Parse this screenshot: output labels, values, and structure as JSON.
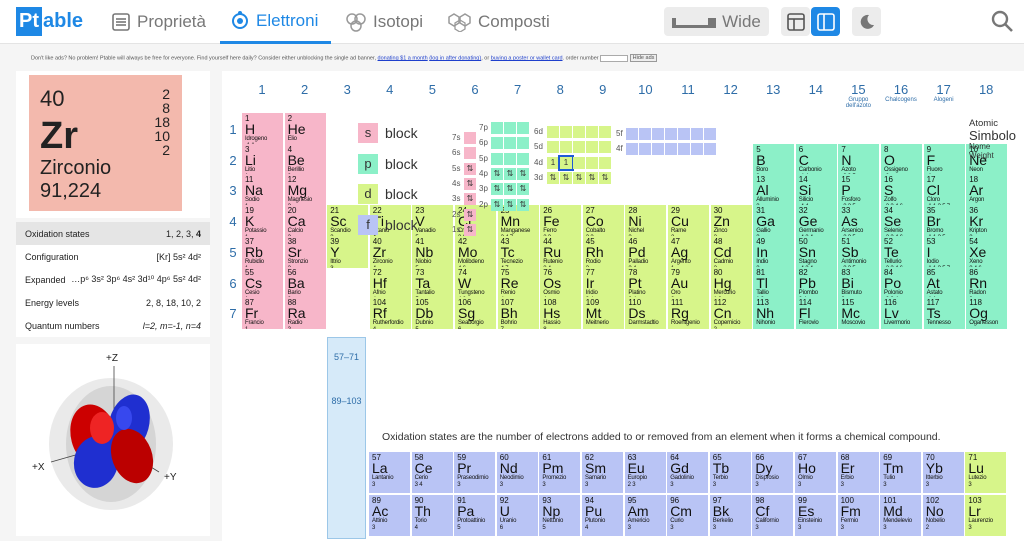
{
  "logo": {
    "part1": "Pt",
    "part2": "able"
  },
  "tabs": [
    {
      "label": "Proprietà"
    },
    {
      "label": "Elettroni"
    },
    {
      "label": "Isotopi"
    },
    {
      "label": "Composti"
    }
  ],
  "wide_label": "Wide",
  "ad": {
    "text1": "Don't like ads? No problem! Ptable will always be free for everyone. Find yourself here daily? Consider either unblocking the single ad banner,",
    "link1": "donating $1 a month",
    "link2": "(log in after donating)",
    "or": ", or",
    "link3": "buying a poster or wallet card",
    "text2": ". order number",
    "hide": "Hide ads"
  },
  "element": {
    "number": "40",
    "symbol": "Zr",
    "name": "Zirconio",
    "weight": "91,224",
    "shells": [
      "2",
      "8",
      "18",
      "10",
      "2"
    ]
  },
  "props": [
    {
      "label": "Oxidation states",
      "value": "1, 2, 3, ",
      "value_bold": "4"
    },
    {
      "label": "Configuration",
      "value": "[Kr] 5s² 4d²"
    },
    {
      "label": "Expanded",
      "value": "…p⁶ 3s² 3p⁶ 4s² 3d¹⁰ 4p⁶ 5s² 4d²"
    },
    {
      "label": "Energy levels",
      "value": "2, 8, 18, 10, 2"
    },
    {
      "label": "Quantum numbers",
      "value": "l=2, m=-1, n=4"
    }
  ],
  "orbital_axes": {
    "z": "+Z",
    "x": "+X",
    "y": "+Y"
  },
  "group_labels": [
    "1",
    "2",
    "3",
    "4",
    "5",
    "6",
    "7",
    "8",
    "9",
    "10",
    "11",
    "12",
    "13",
    "14",
    "15",
    "16",
    "17",
    "18"
  ],
  "group_sublabels": {
    "15": "Gruppo dell'azoto",
    "16": "Chalcogens",
    "17": "Alogeni"
  },
  "period_labels": [
    "1",
    "2",
    "3",
    "4",
    "5",
    "6",
    "7"
  ],
  "f_period_labels": [
    "6",
    "7"
  ],
  "series_labels": {
    "lanthanides": "57–71",
    "actinides": "89–103"
  },
  "blocks": [
    {
      "letter": "s",
      "word": "block",
      "color": "#f7b6c9"
    },
    {
      "letter": "p",
      "word": "block",
      "color": "#8cf0c8"
    },
    {
      "letter": "d",
      "word": "block",
      "color": "#d7f58a"
    },
    {
      "letter": "f",
      "word": "block",
      "color": "#b9c4f5"
    }
  ],
  "orbital_labels": {
    "s": [
      "7s",
      "6s",
      "5s",
      "4s",
      "3s",
      "2s",
      "1s"
    ],
    "p": [
      "7p",
      "6p",
      "5p",
      "4p",
      "3p",
      "2p"
    ],
    "d": [
      "6d",
      "5d",
      "4d",
      "3d"
    ],
    "f": [
      "5f",
      "4f"
    ]
  },
  "orbital_spin_glyph": "⇅",
  "orbital_single_glyph": "1",
  "legend": {
    "l1": "Atomic",
    "l2": "Simbolo",
    "l3": "Nome",
    "l4": "Weight"
  },
  "note": "Oxidation states are the number of electrons added to or removed from an element when it forms a chemical compound.",
  "elements": [
    {
      "n": "1",
      "s": "H",
      "m": "Idrogeno",
      "o": "-1 1",
      "g": 1,
      "p": 1,
      "b": "s"
    },
    {
      "n": "2",
      "s": "He",
      "m": "Elio",
      "o": "",
      "g": 2,
      "p": 1,
      "b": "s"
    },
    {
      "n": "3",
      "s": "Li",
      "m": "Litio",
      "o": "1",
      "g": 1,
      "p": 2,
      "b": "s"
    },
    {
      "n": "4",
      "s": "Be",
      "m": "Berillio",
      "o": "2",
      "g": 2,
      "p": 2,
      "b": "s"
    },
    {
      "n": "5",
      "s": "B",
      "m": "Boro",
      "o": "3",
      "g": 13,
      "p": 2,
      "b": "p"
    },
    {
      "n": "6",
      "s": "C",
      "m": "Carbonio",
      "o": "-4 4",
      "g": 14,
      "p": 2,
      "b": "p"
    },
    {
      "n": "7",
      "s": "N",
      "m": "Azoto",
      "o": "-3 3 5",
      "g": 15,
      "p": 2,
      "b": "p"
    },
    {
      "n": "8",
      "s": "O",
      "m": "Ossigeno",
      "o": "-2",
      "g": 16,
      "p": 2,
      "b": "p"
    },
    {
      "n": "9",
      "s": "F",
      "m": "Fluoro",
      "o": "-1",
      "g": 17,
      "p": 2,
      "b": "p"
    },
    {
      "n": "10",
      "s": "Ne",
      "m": "Neon",
      "o": "",
      "g": 18,
      "p": 2,
      "b": "p"
    },
    {
      "n": "11",
      "s": "Na",
      "m": "Sodio",
      "o": "1",
      "g": 1,
      "p": 3,
      "b": "s"
    },
    {
      "n": "12",
      "s": "Mg",
      "m": "Magnesio",
      "o": "2",
      "g": 2,
      "p": 3,
      "b": "s"
    },
    {
      "n": "13",
      "s": "Al",
      "m": "Alluminio",
      "o": "3",
      "g": 13,
      "p": 3,
      "b": "p"
    },
    {
      "n": "14",
      "s": "Si",
      "m": "Silicio",
      "o": "-4 4",
      "g": 14,
      "p": 3,
      "b": "p"
    },
    {
      "n": "15",
      "s": "P",
      "m": "Fosforo",
      "o": "-3 3 5",
      "g": 15,
      "p": 3,
      "b": "p"
    },
    {
      "n": "16",
      "s": "S",
      "m": "Zolfo",
      "o": "-2 2 4 6",
      "g": 16,
      "p": 3,
      "b": "p"
    },
    {
      "n": "17",
      "s": "Cl",
      "m": "Cloro",
      "o": "-1 1 3 5 7",
      "g": 17,
      "p": 3,
      "b": "p"
    },
    {
      "n": "18",
      "s": "Ar",
      "m": "Argon",
      "o": "",
      "g": 18,
      "p": 3,
      "b": "p"
    },
    {
      "n": "19",
      "s": "K",
      "m": "Potassio",
      "o": "1",
      "g": 1,
      "p": 4,
      "b": "s"
    },
    {
      "n": "20",
      "s": "Ca",
      "m": "Calcio",
      "o": "2",
      "g": 2,
      "p": 4,
      "b": "s"
    },
    {
      "n": "21",
      "s": "Sc",
      "m": "Scandio",
      "o": "3",
      "g": 3,
      "p": 4,
      "b": "d"
    },
    {
      "n": "22",
      "s": "Ti",
      "m": "Titanio",
      "o": "4",
      "g": 4,
      "p": 4,
      "b": "d"
    },
    {
      "n": "23",
      "s": "V",
      "m": "Vanadio",
      "o": "5",
      "g": 5,
      "p": 4,
      "b": "d"
    },
    {
      "n": "24",
      "s": "Cr",
      "m": "Cromo",
      "o": "3 6",
      "g": 6,
      "p": 4,
      "b": "d"
    },
    {
      "n": "25",
      "s": "Mn",
      "m": "Manganese",
      "o": "2 4 7",
      "g": 7,
      "p": 4,
      "b": "d"
    },
    {
      "n": "26",
      "s": "Fe",
      "m": "Ferro",
      "o": "2 3",
      "g": 8,
      "p": 4,
      "b": "d"
    },
    {
      "n": "27",
      "s": "Co",
      "m": "Cobalto",
      "o": "2 3",
      "g": 9,
      "p": 4,
      "b": "d"
    },
    {
      "n": "28",
      "s": "Ni",
      "m": "Nichel",
      "o": "2",
      "g": 10,
      "p": 4,
      "b": "d"
    },
    {
      "n": "29",
      "s": "Cu",
      "m": "Rame",
      "o": "2",
      "g": 11,
      "p": 4,
      "b": "d"
    },
    {
      "n": "30",
      "s": "Zn",
      "m": "Zinco",
      "o": "2",
      "g": 12,
      "p": 4,
      "b": "d"
    },
    {
      "n": "31",
      "s": "Ga",
      "m": "Gallio",
      "o": "3",
      "g": 13,
      "p": 4,
      "b": "p"
    },
    {
      "n": "32",
      "s": "Ge",
      "m": "Germanio",
      "o": "-4 2 4",
      "g": 14,
      "p": 4,
      "b": "p"
    },
    {
      "n": "33",
      "s": "As",
      "m": "Arsenico",
      "o": "-3 3 5",
      "g": 15,
      "p": 4,
      "b": "p"
    },
    {
      "n": "34",
      "s": "Se",
      "m": "Selenio",
      "o": "-2 2 4 6",
      "g": 16,
      "p": 4,
      "b": "p"
    },
    {
      "n": "35",
      "s": "Br",
      "m": "Bromo",
      "o": "-1 1 3 5",
      "g": 17,
      "p": 4,
      "b": "p"
    },
    {
      "n": "36",
      "s": "Kr",
      "m": "Kripton",
      "o": "2",
      "g": 18,
      "p": 4,
      "b": "p"
    },
    {
      "n": "37",
      "s": "Rb",
      "m": "Rubidio",
      "o": "1",
      "g": 1,
      "p": 5,
      "b": "s"
    },
    {
      "n": "38",
      "s": "Sr",
      "m": "Stronzio",
      "o": "2",
      "g": 2,
      "p": 5,
      "b": "s"
    },
    {
      "n": "39",
      "s": "Y",
      "m": "Ittrio",
      "o": "3",
      "g": 3,
      "p": 5,
      "b": "d"
    },
    {
      "n": "40",
      "s": "Zr",
      "m": "Zirconio",
      "o": "4",
      "g": 4,
      "p": 5,
      "b": "d"
    },
    {
      "n": "41",
      "s": "Nb",
      "m": "Niobio",
      "o": "5",
      "g": 5,
      "p": 5,
      "b": "d"
    },
    {
      "n": "42",
      "s": "Mo",
      "m": "Molibdeno",
      "o": "4 6",
      "g": 6,
      "p": 5,
      "b": "d"
    },
    {
      "n": "43",
      "s": "Tc",
      "m": "Tecnezio",
      "o": "4 7",
      "g": 7,
      "p": 5,
      "b": "d"
    },
    {
      "n": "44",
      "s": "Ru",
      "m": "Rutenio",
      "o": "3 4",
      "g": 8,
      "p": 5,
      "b": "d"
    },
    {
      "n": "45",
      "s": "Rh",
      "m": "Rodio",
      "o": "3",
      "g": 9,
      "p": 5,
      "b": "d"
    },
    {
      "n": "46",
      "s": "Pd",
      "m": "Palladio",
      "o": "2 4",
      "g": 10,
      "p": 5,
      "b": "d"
    },
    {
      "n": "47",
      "s": "Ag",
      "m": "Argento",
      "o": "1",
      "g": 11,
      "p": 5,
      "b": "d"
    },
    {
      "n": "48",
      "s": "Cd",
      "m": "Cadmio",
      "o": "2",
      "g": 12,
      "p": 5,
      "b": "d"
    },
    {
      "n": "49",
      "s": "In",
      "m": "Indio",
      "o": "3",
      "g": 13,
      "p": 5,
      "b": "p"
    },
    {
      "n": "50",
      "s": "Sn",
      "m": "Stagno",
      "o": "-4 2 4",
      "g": 14,
      "p": 5,
      "b": "p"
    },
    {
      "n": "51",
      "s": "Sb",
      "m": "Antimonio",
      "o": "-3 3 5",
      "g": 15,
      "p": 5,
      "b": "p"
    },
    {
      "n": "52",
      "s": "Te",
      "m": "Tellurio",
      "o": "-2 2 4 6",
      "g": 16,
      "p": 5,
      "b": "p"
    },
    {
      "n": "53",
      "s": "I",
      "m": "Iodio",
      "o": "-1 1 3 5 7",
      "g": 17,
      "p": 5,
      "b": "p"
    },
    {
      "n": "54",
      "s": "Xe",
      "m": "Xeno",
      "o": "2 4 6",
      "g": 18,
      "p": 5,
      "b": "p"
    },
    {
      "n": "55",
      "s": "Cs",
      "m": "Cesio",
      "o": "1",
      "g": 1,
      "p": 6,
      "b": "s"
    },
    {
      "n": "56",
      "s": "Ba",
      "m": "Bario",
      "o": "2",
      "g": 2,
      "p": 6,
      "b": "s"
    },
    {
      "n": "72",
      "s": "Hf",
      "m": "Afnio",
      "o": "4",
      "g": 4,
      "p": 6,
      "b": "d"
    },
    {
      "n": "73",
      "s": "Ta",
      "m": "Tantalio",
      "o": "5",
      "g": 5,
      "p": 6,
      "b": "d"
    },
    {
      "n": "74",
      "s": "W",
      "m": "Tungsteno",
      "o": "4 6",
      "g": 6,
      "p": 6,
      "b": "d"
    },
    {
      "n": "75",
      "s": "Re",
      "m": "Renio",
      "o": "4",
      "g": 7,
      "p": 6,
      "b": "d"
    },
    {
      "n": "76",
      "s": "Os",
      "m": "Osmio",
      "o": "4",
      "g": 8,
      "p": 6,
      "b": "d"
    },
    {
      "n": "77",
      "s": "Ir",
      "m": "Iridio",
      "o": "3 4",
      "g": 9,
      "p": 6,
      "b": "d"
    },
    {
      "n": "78",
      "s": "Pt",
      "m": "Platino",
      "o": "2 4",
      "g": 10,
      "p": 6,
      "b": "d"
    },
    {
      "n": "79",
      "s": "Au",
      "m": "Oro",
      "o": "3",
      "g": 11,
      "p": 6,
      "b": "d"
    },
    {
      "n": "80",
      "s": "Hg",
      "m": "Mercurio",
      "o": "1 2",
      "g": 12,
      "p": 6,
      "b": "d"
    },
    {
      "n": "81",
      "s": "Tl",
      "m": "Tallio",
      "o": "1 3",
      "g": 13,
      "p": 6,
      "b": "p"
    },
    {
      "n": "82",
      "s": "Pb",
      "m": "Piombo",
      "o": "2 4",
      "g": 14,
      "p": 6,
      "b": "p"
    },
    {
      "n": "83",
      "s": "Bi",
      "m": "Bismuto",
      "o": "3",
      "g": 15,
      "p": 6,
      "b": "p"
    },
    {
      "n": "84",
      "s": "Po",
      "m": "Polonio",
      "o": "-2 2 4",
      "g": 16,
      "p": 6,
      "b": "p"
    },
    {
      "n": "85",
      "s": "At",
      "m": "Astato",
      "o": "-1 1",
      "g": 17,
      "p": 6,
      "b": "p"
    },
    {
      "n": "86",
      "s": "Rn",
      "m": "Radon",
      "o": "2",
      "g": 18,
      "p": 6,
      "b": "p"
    },
    {
      "n": "87",
      "s": "Fr",
      "m": "Francio",
      "o": "1",
      "g": 1,
      "p": 7,
      "b": "s"
    },
    {
      "n": "88",
      "s": "Ra",
      "m": "Radio",
      "o": "2",
      "g": 2,
      "p": 7,
      "b": "s"
    },
    {
      "n": "104",
      "s": "Rf",
      "m": "Rutherfordio",
      "o": "4",
      "g": 4,
      "p": 7,
      "b": "d"
    },
    {
      "n": "105",
      "s": "Db",
      "m": "Dubnio",
      "o": "5",
      "g": 5,
      "p": 7,
      "b": "d"
    },
    {
      "n": "106",
      "s": "Sg",
      "m": "Seaborgio",
      "o": "6",
      "g": 6,
      "p": 7,
      "b": "d"
    },
    {
      "n": "107",
      "s": "Bh",
      "m": "Bohrio",
      "o": "7",
      "g": 7,
      "p": 7,
      "b": "d"
    },
    {
      "n": "108",
      "s": "Hs",
      "m": "Hassio",
      "o": "8",
      "g": 8,
      "p": 7,
      "b": "d"
    },
    {
      "n": "109",
      "s": "Mt",
      "m": "Meitnerio",
      "o": "",
      "g": 9,
      "p": 7,
      "b": "d"
    },
    {
      "n": "110",
      "s": "Ds",
      "m": "Darmstadtio",
      "o": "",
      "g": 10,
      "p": 7,
      "b": "d"
    },
    {
      "n": "111",
      "s": "Rg",
      "m": "Roentgenio",
      "o": "",
      "g": 11,
      "p": 7,
      "b": "d"
    },
    {
      "n": "112",
      "s": "Cn",
      "m": "Copernicio",
      "o": "2",
      "g": 12,
      "p": 7,
      "b": "d"
    },
    {
      "n": "113",
      "s": "Nh",
      "m": "Nihonio",
      "o": "",
      "g": 13,
      "p": 7,
      "b": "p"
    },
    {
      "n": "114",
      "s": "Fl",
      "m": "Flerovio",
      "o": "",
      "g": 14,
      "p": 7,
      "b": "p"
    },
    {
      "n": "115",
      "s": "Mc",
      "m": "Moscovio",
      "o": "",
      "g": 15,
      "p": 7,
      "b": "p"
    },
    {
      "n": "116",
      "s": "Lv",
      "m": "Livermorio",
      "o": "",
      "g": 16,
      "p": 7,
      "b": "p"
    },
    {
      "n": "117",
      "s": "Ts",
      "m": "Tennesso",
      "o": "",
      "g": 17,
      "p": 7,
      "b": "p"
    },
    {
      "n": "118",
      "s": "Og",
      "m": "Oganesson",
      "o": "",
      "g": 18,
      "p": 7,
      "b": "p"
    }
  ],
  "f_elements": [
    {
      "n": "57",
      "s": "La",
      "m": "Lantanio",
      "o": "3",
      "c": 0,
      "r": 0,
      "b": "f"
    },
    {
      "n": "58",
      "s": "Ce",
      "m": "Cerio",
      "o": "3 4",
      "c": 1,
      "r": 0,
      "b": "f"
    },
    {
      "n": "59",
      "s": "Pr",
      "m": "Praseodimio",
      "o": "3",
      "c": 2,
      "r": 0,
      "b": "f"
    },
    {
      "n": "60",
      "s": "Nd",
      "m": "Neodimio",
      "o": "3",
      "c": 3,
      "r": 0,
      "b": "f"
    },
    {
      "n": "61",
      "s": "Pm",
      "m": "Promezio",
      "o": "3",
      "c": 4,
      "r": 0,
      "b": "f"
    },
    {
      "n": "62",
      "s": "Sm",
      "m": "Samario",
      "o": "3",
      "c": 5,
      "r": 0,
      "b": "f"
    },
    {
      "n": "63",
      "s": "Eu",
      "m": "Europio",
      "o": "2 3",
      "c": 6,
      "r": 0,
      "b": "f"
    },
    {
      "n": "64",
      "s": "Gd",
      "m": "Gadolinio",
      "o": "3",
      "c": 7,
      "r": 0,
      "b": "f"
    },
    {
      "n": "65",
      "s": "Tb",
      "m": "Terbio",
      "o": "3",
      "c": 8,
      "r": 0,
      "b": "f"
    },
    {
      "n": "66",
      "s": "Dy",
      "m": "Disprosio",
      "o": "3",
      "c": 9,
      "r": 0,
      "b": "f"
    },
    {
      "n": "67",
      "s": "Ho",
      "m": "Olmio",
      "o": "3",
      "c": 10,
      "r": 0,
      "b": "f"
    },
    {
      "n": "68",
      "s": "Er",
      "m": "Erbio",
      "o": "3",
      "c": 11,
      "r": 0,
      "b": "f"
    },
    {
      "n": "69",
      "s": "Tm",
      "m": "Tulio",
      "o": "3",
      "c": 12,
      "r": 0,
      "b": "f"
    },
    {
      "n": "70",
      "s": "Yb",
      "m": "Itterbio",
      "o": "3",
      "c": 13,
      "r": 0,
      "b": "f"
    },
    {
      "n": "71",
      "s": "Lu",
      "m": "Lutezio",
      "o": "3",
      "c": 14,
      "r": 0,
      "b": "d"
    },
    {
      "n": "89",
      "s": "Ac",
      "m": "Attinio",
      "o": "3",
      "c": 0,
      "r": 1,
      "b": "f"
    },
    {
      "n": "90",
      "s": "Th",
      "m": "Torio",
      "o": "4",
      "c": 1,
      "r": 1,
      "b": "f"
    },
    {
      "n": "91",
      "s": "Pa",
      "m": "Protoattinio",
      "o": "5",
      "c": 2,
      "r": 1,
      "b": "f"
    },
    {
      "n": "92",
      "s": "U",
      "m": "Uranio",
      "o": "6",
      "c": 3,
      "r": 1,
      "b": "f"
    },
    {
      "n": "93",
      "s": "Np",
      "m": "Nettunio",
      "o": "5",
      "c": 4,
      "r": 1,
      "b": "f"
    },
    {
      "n": "94",
      "s": "Pu",
      "m": "Plutonio",
      "o": "4",
      "c": 5,
      "r": 1,
      "b": "f"
    },
    {
      "n": "95",
      "s": "Am",
      "m": "Americio",
      "o": "3",
      "c": 6,
      "r": 1,
      "b": "f"
    },
    {
      "n": "96",
      "s": "Cm",
      "m": "Curio",
      "o": "3",
      "c": 7,
      "r": 1,
      "b": "f"
    },
    {
      "n": "97",
      "s": "Bk",
      "m": "Berkelio",
      "o": "3",
      "c": 8,
      "r": 1,
      "b": "f"
    },
    {
      "n": "98",
      "s": "Cf",
      "m": "Californio",
      "o": "3",
      "c": 9,
      "r": 1,
      "b": "f"
    },
    {
      "n": "99",
      "s": "Es",
      "m": "Einsteinio",
      "o": "3",
      "c": 10,
      "r": 1,
      "b": "f"
    },
    {
      "n": "100",
      "s": "Fm",
      "m": "Fermio",
      "o": "3",
      "c": 11,
      "r": 1,
      "b": "f"
    },
    {
      "n": "101",
      "s": "Md",
      "m": "Mendelevio",
      "o": "3",
      "c": 12,
      "r": 1,
      "b": "f"
    },
    {
      "n": "102",
      "s": "No",
      "m": "Nobelio",
      "o": "2",
      "c": 13,
      "r": 1,
      "b": "f"
    },
    {
      "n": "103",
      "s": "Lr",
      "m": "Laurenzio",
      "o": "3",
      "c": 14,
      "r": 1,
      "b": "d"
    }
  ],
  "colors": {
    "s": "#f7b6c9",
    "p": "#8cf0c8",
    "d": "#d7f58a",
    "f": "#b9c4f5",
    "accent": "#1e88e5",
    "selected": "#f3b9ad"
  }
}
